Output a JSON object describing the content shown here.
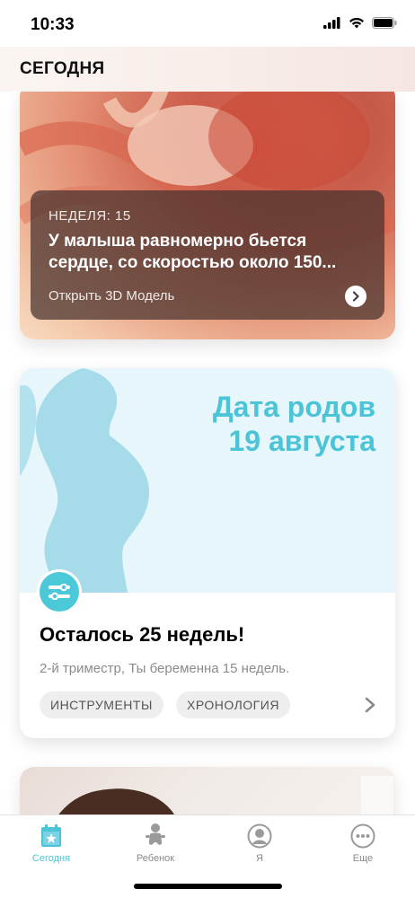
{
  "status": {
    "time": "10:33"
  },
  "header": {
    "title": "СЕГОДНЯ"
  },
  "model_card": {
    "week_label": "НЕДЕЛЯ: 15",
    "text_line1": "У малыша равномерно бьется",
    "text_line2": "сердце, со скоростью около 150...",
    "link": "Открыть 3D Модель"
  },
  "due_card": {
    "label_line1": "Дата родов",
    "label_line2": "19 августа",
    "remaining": "Осталось 25 недель!",
    "subtitle": "2-й триместр, Ты беременна 15 недель.",
    "chips": [
      "ИНСТРУМЕНТЫ",
      "ХРОНОЛОГИЯ"
    ]
  },
  "tabs": [
    {
      "label": "Сегодня",
      "active": true
    },
    {
      "label": "Ребенок",
      "active": false
    },
    {
      "label": "Я",
      "active": false
    },
    {
      "label": "Еще",
      "active": false
    }
  ],
  "colors": {
    "accent": "#4cc4d8",
    "overlay": "#46302c",
    "due_bg": "#e6f6fa"
  }
}
